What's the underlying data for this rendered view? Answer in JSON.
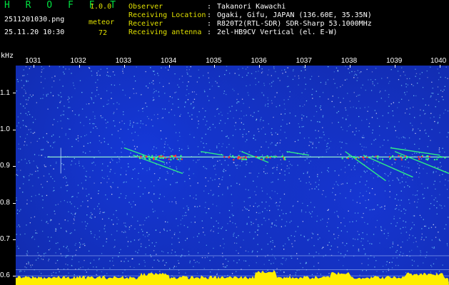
{
  "header": {
    "app_title": "H R O F F T",
    "version": "1.0.0",
    "file_name": "2511201030.png",
    "datetime": "25.11.20 10:30",
    "meteor_label": "meteor",
    "meteor_count": "72"
  },
  "info": [
    {
      "label": "Observer",
      "value": "Takanori Kawachi"
    },
    {
      "label": "Receiving Location",
      "value": "Ogaki, Gifu, JAPAN (136.60E, 35.35N)"
    },
    {
      "label": "Receiver",
      "value": "R820T2(RTL-SDR) SDR-Sharp 53.1000MHz"
    },
    {
      "label": "Receiving antenna",
      "value": "2el-HB9CV Vertical (el. E-W)"
    }
  ],
  "chart_data": {
    "type": "heatmap",
    "ylabel": "kHz",
    "xticks": [
      "1031",
      "1032",
      "1033",
      "1034",
      "1035",
      "1036",
      "1037",
      "1038",
      "1039",
      "1040"
    ],
    "yticks": [
      "1.1",
      "1.0",
      "0.9",
      "0.8",
      "0.7",
      "0.6"
    ],
    "xlim": [
      1030.6,
      1040.2
    ],
    "ylim": [
      0.575,
      1.175
    ],
    "carrier_khz": 0.925,
    "colors": {
      "background": "#112aa8",
      "noise": "#7fe0ff",
      "echo": "#30ff80",
      "strong": "#ff3030",
      "level": "#ffee00"
    }
  }
}
